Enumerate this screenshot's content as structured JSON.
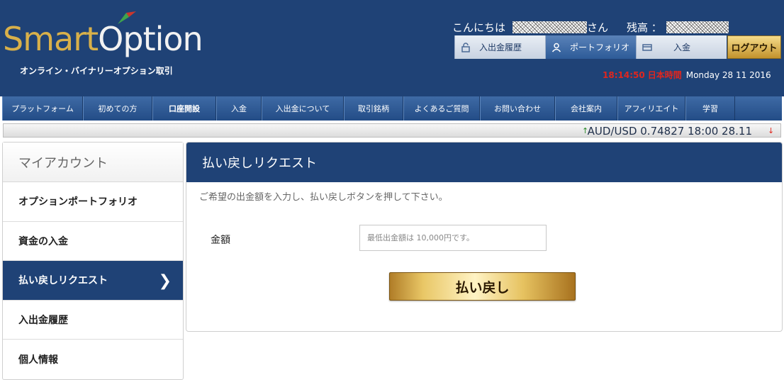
{
  "header": {
    "logo_part1": "Smart",
    "logo_part2": "Option",
    "tagline": "オンライン・バイナリーオプション取引",
    "greeting": "こんにちは",
    "greeting_suffix": "さん",
    "balance_label": "残高 ：",
    "buttons": {
      "history": "入出金履歴",
      "portfolio": "ポートフォリオ",
      "deposit": "入金",
      "logout": "ログアウト"
    },
    "clock": {
      "time": "18:14:50",
      "zone": "日本時間",
      "date": "Monday 28 11 2016"
    }
  },
  "nav": {
    "items": [
      {
        "label": "プラットフォーム"
      },
      {
        "label": "初めての方"
      },
      {
        "label": "口座開設"
      },
      {
        "label": "入金"
      },
      {
        "label": "入出金について"
      },
      {
        "label": "取引銘柄"
      },
      {
        "label": "よくあるご質問"
      },
      {
        "label": "お問い合わせ"
      },
      {
        "label": "会社案内"
      },
      {
        "label": "アフィリエイト"
      },
      {
        "label": "学習"
      }
    ]
  },
  "ticker": {
    "text": "AUD/USD 0.74827 18:00 28.11",
    "up_icon": "↑",
    "down_icon": "↓"
  },
  "sidebar": {
    "title": "マイアカウント",
    "items": [
      {
        "label": "オプションポートフォリオ"
      },
      {
        "label": "資金の入金"
      },
      {
        "label": "払い戻しリクエスト",
        "chevron": "❯"
      },
      {
        "label": "入出金履歴"
      },
      {
        "label": "個人情報"
      }
    ]
  },
  "panel": {
    "title": "払い戻しリクエスト",
    "instructions": "ご希望の出金額を入力し、払い戻しボタンを押して下さい。",
    "amount_label": "金額",
    "amount_value": "",
    "amount_placeholder": "最低出金額は 10,000円です。",
    "submit_label": "払い戻し"
  },
  "colors": {
    "header_bg": "#1f4276",
    "accent_gold": "#d8b04a",
    "clock_red": "#e0261e"
  }
}
